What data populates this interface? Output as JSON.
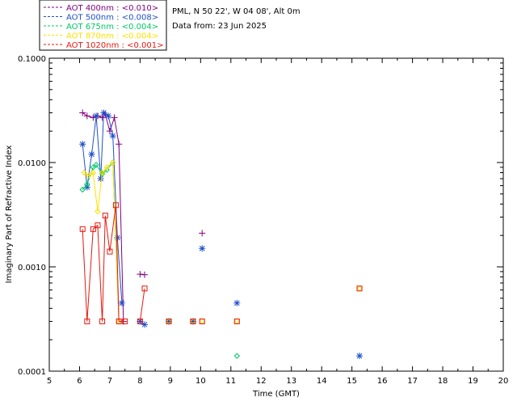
{
  "chart_data": {
    "type": "line",
    "xlabel": "Time (GMT)",
    "ylabel": "Imaginary Part of Refractive Index",
    "xlim": [
      5,
      20
    ],
    "ylim": [
      0.0001,
      0.1
    ],
    "y_scale": "log",
    "x_ticks": [
      "5",
      "6",
      "7",
      "8",
      "9",
      "10",
      "11",
      "12",
      "13",
      "14",
      "15",
      "16",
      "17",
      "18",
      "19",
      "20"
    ],
    "y_ticks": [
      {
        "value": 0.0001,
        "label": "0.0001"
      },
      {
        "value": 0.001,
        "label": "0.0010"
      },
      {
        "value": 0.01,
        "label": "0.0100"
      },
      {
        "value": 0.1,
        "label": "0.1000"
      }
    ],
    "info": {
      "site": "PML, N 50 22', W 04 08', Alt 0m",
      "date": "Data from: 23 Jun 2025"
    },
    "series": [
      {
        "name": "AOT  400nm : <0.010>",
        "color": "#800080",
        "marker": "plus",
        "segments": [
          [
            [
              6.1,
              0.03
            ],
            [
              6.25,
              0.028
            ],
            [
              6.45,
              0.027
            ],
            [
              6.6,
              0.028
            ],
            [
              6.75,
              0.027
            ],
            [
              6.85,
              0.029
            ],
            [
              7.0,
              0.02
            ],
            [
              7.15,
              0.027
            ],
            [
              7.3,
              0.015
            ],
            [
              7.45,
              0.0003
            ]
          ],
          [
            [
              8.0,
              0.00085
            ],
            [
              8.15,
              0.00084
            ]
          ]
        ],
        "points": [
          [
            10.05,
            0.0021
          ]
        ]
      },
      {
        "name": "AOT  500nm : <0.008>",
        "color": "#1F4FC9",
        "marker": "asterisk",
        "segments": [
          [
            [
              6.1,
              0.015
            ],
            [
              6.25,
              0.0058
            ],
            [
              6.4,
              0.012
            ],
            [
              6.55,
              0.028
            ],
            [
              6.7,
              0.007
            ],
            [
              6.8,
              0.03
            ],
            [
              6.95,
              0.028
            ],
            [
              7.1,
              0.018
            ],
            [
              7.25,
              0.0019
            ],
            [
              7.4,
              0.00045
            ]
          ],
          [
            [
              8.0,
              0.0003
            ],
            [
              8.15,
              0.00028
            ]
          ]
        ],
        "points": [
          [
            8.95,
            0.0003
          ],
          [
            9.75,
            0.0003
          ],
          [
            10.05,
            0.0015
          ],
          [
            11.2,
            0.00045
          ],
          [
            15.25,
            0.00014
          ]
        ]
      },
      {
        "name": "AOT  675nm : <0.004>",
        "color": "#00C864",
        "marker": "diamond",
        "segments": [
          [
            [
              6.1,
              0.0055
            ],
            [
              6.25,
              0.0062
            ],
            [
              6.45,
              0.009
            ],
            [
              6.55,
              0.0095
            ],
            [
              6.75,
              0.0078
            ],
            [
              6.9,
              0.0085
            ],
            [
              7.1,
              0.01
            ],
            [
              7.3,
              0.0003
            ]
          ]
        ],
        "points": [
          [
            8.95,
            0.0003
          ],
          [
            9.75,
            0.0003
          ],
          [
            11.2,
            0.00014
          ]
        ]
      },
      {
        "name": "AOT  870nm : <0.004>",
        "color": "#FFE000",
        "marker": "diamond",
        "segments": [
          [
            [
              6.15,
              0.008
            ],
            [
              6.3,
              0.0075
            ],
            [
              6.45,
              0.008
            ],
            [
              6.6,
              0.0034
            ],
            [
              6.75,
              0.008
            ],
            [
              6.9,
              0.009
            ],
            [
              7.1,
              0.01
            ],
            [
              7.3,
              0.0003
            ]
          ]
        ],
        "points": [
          [
            8.95,
            0.0003
          ],
          [
            9.75,
            0.0003
          ],
          [
            10.05,
            0.0003
          ],
          [
            11.2,
            0.0003
          ],
          [
            15.25,
            0.00062
          ]
        ]
      },
      {
        "name": "AOT 1020nm : <0.001>",
        "color": "#E8170E",
        "marker": "square",
        "segments": [
          [
            [
              6.1,
              0.0023
            ],
            [
              6.25,
              0.0003
            ],
            [
              6.45,
              0.0023
            ],
            [
              6.6,
              0.0025
            ],
            [
              6.75,
              0.0003
            ],
            [
              6.85,
              0.0031
            ],
            [
              7.0,
              0.0014
            ],
            [
              7.2,
              0.0039
            ],
            [
              7.3,
              0.0003
            ],
            [
              7.5,
              0.0003
            ]
          ],
          [
            [
              8.0,
              0.0003
            ],
            [
              8.15,
              0.00062
            ]
          ]
        ],
        "points": [
          [
            8.95,
            0.0003
          ],
          [
            9.75,
            0.0003
          ],
          [
            10.05,
            0.0003
          ],
          [
            11.2,
            0.0003
          ],
          [
            15.25,
            0.00062
          ]
        ]
      }
    ]
  }
}
